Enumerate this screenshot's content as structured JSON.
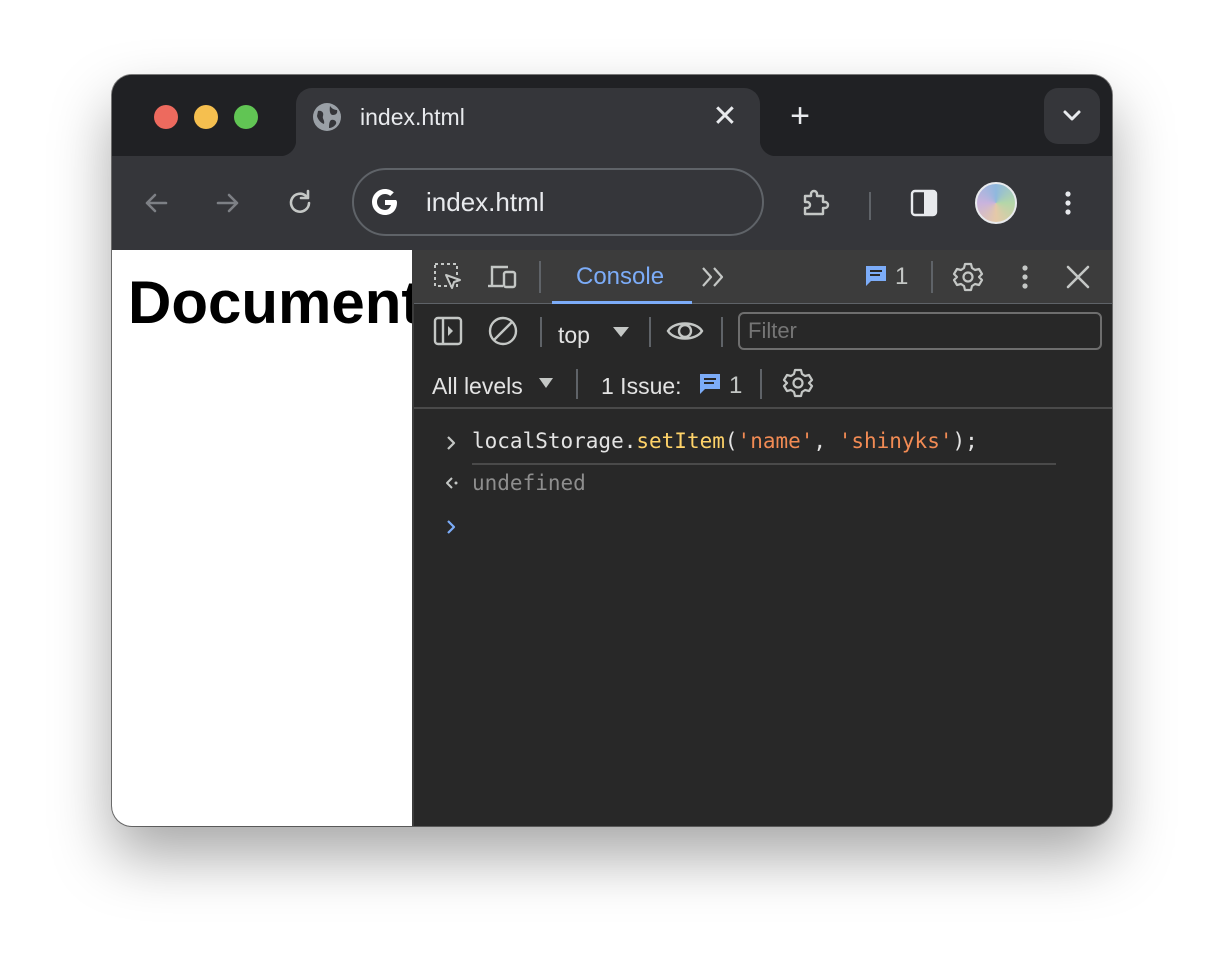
{
  "tab": {
    "title": "index.html",
    "close_glyph": "✕"
  },
  "new_tab_glyph": "+",
  "omnibox": {
    "text": "index.html"
  },
  "page": {
    "heading": "Document"
  },
  "devtools": {
    "console_tab_label": "Console",
    "issues_count": "1",
    "context_label": "top",
    "filter_placeholder": "Filter",
    "levels_label": "All levels",
    "issues_label": "1 Issue:",
    "issues_badge_count": "1",
    "console": {
      "input_line": {
        "obj": "localStorage",
        "dot": ".",
        "method": "setItem",
        "open": "(",
        "arg1": "'name'",
        "comma": ", ",
        "arg2": "'shinyks'",
        "close": ");"
      },
      "result": "undefined"
    }
  },
  "colors": {
    "accent": "#7cacf8",
    "function": "#ffd369",
    "string": "#f28b54",
    "issue_badge": "#7cacf8"
  }
}
